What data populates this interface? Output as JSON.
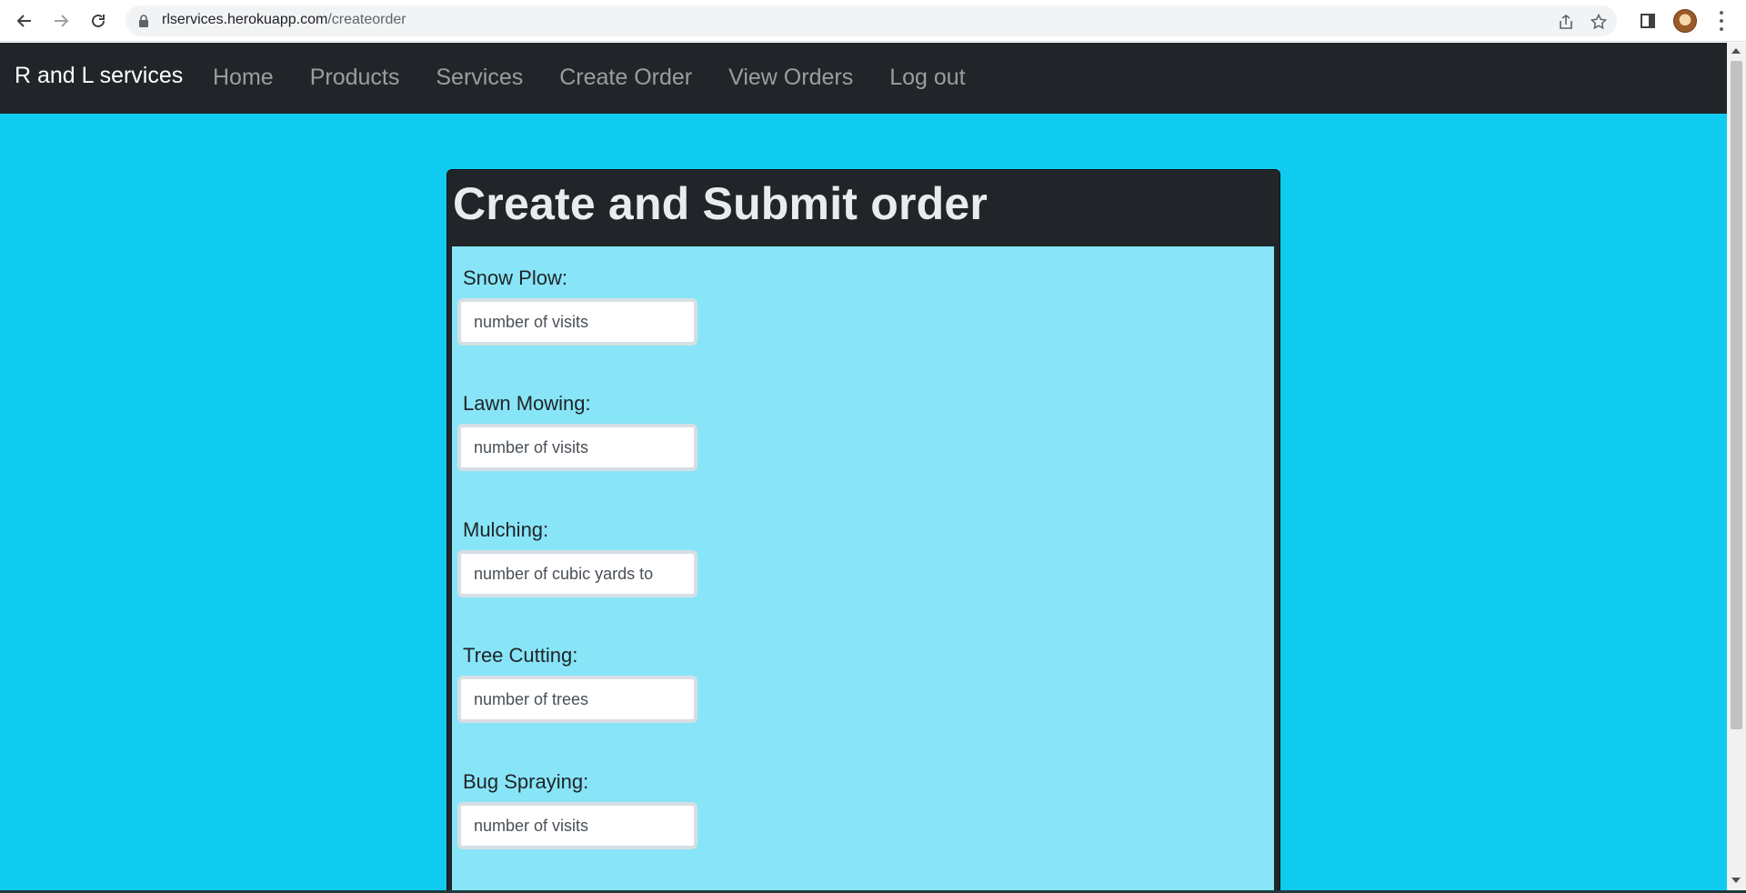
{
  "browser": {
    "url_host": "rlservices.herokuapp.com",
    "url_path": "/createorder",
    "icons": [
      "back-arrow-icon",
      "forward-arrow-icon",
      "reload-icon",
      "lock-icon",
      "share-icon",
      "star-icon",
      "side-panel-icon",
      "profile-avatar",
      "more-menu-icon"
    ]
  },
  "navbar": {
    "brand": "R and L services",
    "links": [
      "Home",
      "Products",
      "Services",
      "Create Order",
      "View Orders",
      "Log out"
    ]
  },
  "card": {
    "title": "Create and Submit order"
  },
  "form": {
    "fields": [
      {
        "label": "Snow Plow:",
        "placeholder": "number of visits"
      },
      {
        "label": "Lawn Mowing:",
        "placeholder": "number of visits"
      },
      {
        "label": "Mulching:",
        "placeholder": "number of cubic yards to"
      },
      {
        "label": "Tree Cutting:",
        "placeholder": "number of trees"
      },
      {
        "label": "Bug Spraying:",
        "placeholder": "number of visits"
      }
    ]
  },
  "colors": {
    "page_background": "#0fcbef",
    "navbar_background": "#212529",
    "card_body_background": "#87e5f7"
  }
}
